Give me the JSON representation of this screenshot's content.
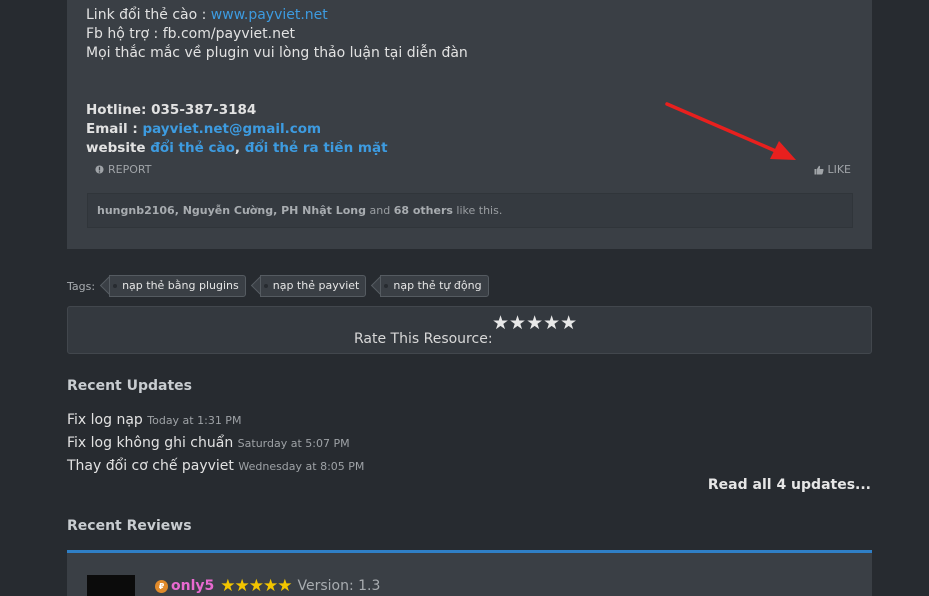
{
  "post": {
    "line1_label": "Link đổi thẻ cào : ",
    "line1_link": "www.payviet.net",
    "line2": "Fb hộ trợ : fb.com/payviet.net",
    "line3": "Mọi thắc mắc về plugin vui lòng thảo luận tại diễn đàn",
    "hotline": "Hotline: 035-387-3184",
    "email_label": "Email : ",
    "email_link": "payviet.net@gmail.com",
    "website_label": "website ",
    "website_link1": "đổi thẻ cào",
    "website_sep": ", ",
    "website_link2": "đổi thẻ ra tiền mặt",
    "report_label": "REPORT",
    "like_label": "LIKE",
    "likes_users": "hungnb2106, Nguyễn Cường, PH Nhật Long",
    "likes_and": " and ",
    "likes_others": "68 others",
    "likes_suffix": " like this."
  },
  "tags": {
    "label": "Tags:",
    "items": [
      "nạp thẻ bằng plugins",
      "nạp thẻ payviet",
      "nạp thẻ tự động"
    ]
  },
  "rating": {
    "stars": "★★★★★",
    "label": "Rate This Resource:"
  },
  "recent_updates": {
    "title": "Recent Updates",
    "items": [
      {
        "text": "Fix log nạp",
        "time": "Today at 1:31 PM"
      },
      {
        "text": "Fix log không ghi chuẩn",
        "time": "Saturday at 5:07 PM"
      },
      {
        "text": "Thay đổi cơ chế payviet",
        "time": "Wednesday at 8:05 PM"
      }
    ],
    "read_all": "Read all 4 updates..."
  },
  "recent_reviews": {
    "title": "Recent Reviews",
    "first": {
      "user": "only5",
      "stars": "★★★★★",
      "version": "Version: 1.3"
    }
  },
  "colors": {
    "background": "#272b30",
    "card": "#3a3f45",
    "link": "#3d9be0",
    "accent_bar": "#2f7fc6",
    "arrow": "#e8201e",
    "review_user": "#e86ad0",
    "review_stars": "#f2c500"
  },
  "icons": [
    "report-icon",
    "thumbs-up-icon",
    "red-arrow-annotation",
    "tag-icon",
    "user-badge-icon"
  ]
}
